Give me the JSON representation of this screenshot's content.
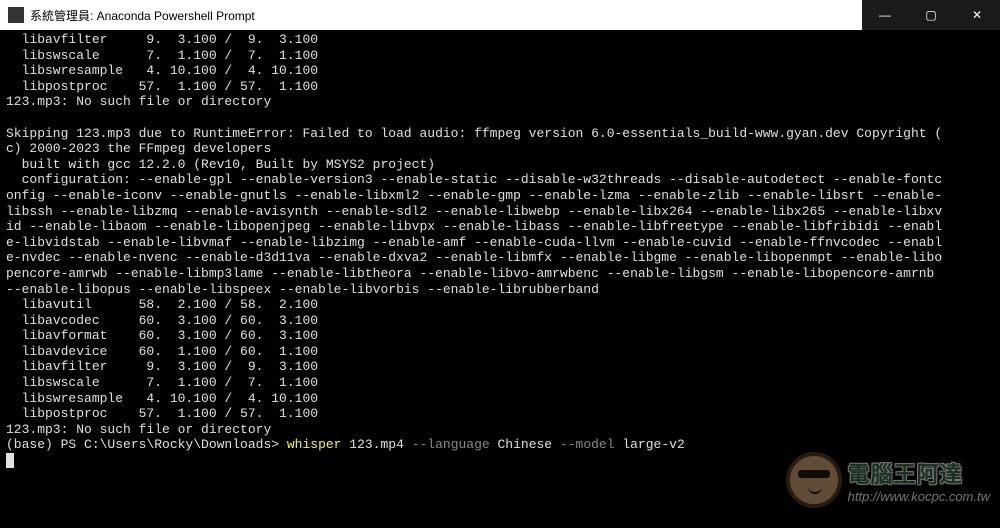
{
  "titlebar": {
    "text": "系統管理員: Anaconda Powershell Prompt",
    "min": "—",
    "max": "▢",
    "close": "✕"
  },
  "terminal": {
    "lines": [
      "  libavfilter     9.  3.100 /  9.  3.100",
      "  libswscale      7.  1.100 /  7.  1.100",
      "  libswresample   4. 10.100 /  4. 10.100",
      "  libpostproc    57.  1.100 / 57.  1.100",
      "123.mp3: No such file or directory",
      "",
      "Skipping 123.mp3 due to RuntimeError: Failed to load audio: ffmpeg version 6.0-essentials_build-www.gyan.dev Copyright (",
      "c) 2000-2023 the FFmpeg developers",
      "  built with gcc 12.2.0 (Rev10, Built by MSYS2 project)",
      "  configuration: --enable-gpl --enable-version3 --enable-static --disable-w32threads --disable-autodetect --enable-fontc",
      "onfig --enable-iconv --enable-gnutls --enable-libxml2 --enable-gmp --enable-lzma --enable-zlib --enable-libsrt --enable-",
      "libssh --enable-libzmq --enable-avisynth --enable-sdl2 --enable-libwebp --enable-libx264 --enable-libx265 --enable-libxv",
      "id --enable-libaom --enable-libopenjpeg --enable-libvpx --enable-libass --enable-libfreetype --enable-libfribidi --enabl",
      "e-libvidstab --enable-libvmaf --enable-libzimg --enable-amf --enable-cuda-llvm --enable-cuvid --enable-ffnvcodec --enabl",
      "e-nvdec --enable-nvenc --enable-d3d11va --enable-dxva2 --enable-libmfx --enable-libgme --enable-libopenmpt --enable-libo",
      "pencore-amrwb --enable-libmp3lame --enable-libtheora --enable-libvo-amrwbenc --enable-libgsm --enable-libopencore-amrnb ",
      "--enable-libopus --enable-libspeex --enable-libvorbis --enable-librubberband",
      "  libavutil      58.  2.100 / 58.  2.100",
      "  libavcodec     60.  3.100 / 60.  3.100",
      "  libavformat    60.  3.100 / 60.  3.100",
      "  libavdevice    60.  1.100 / 60.  1.100",
      "  libavfilter     9.  3.100 /  9.  3.100",
      "  libswscale      7.  1.100 /  7.  1.100",
      "  libswresample   4. 10.100 /  4. 10.100",
      "  libpostproc    57.  1.100 / 57.  1.100",
      "123.mp3: No such file or directory",
      ""
    ],
    "prompt_prefix": "(base) PS C:\\Users\\Rocky\\Downloads> ",
    "cmd_word": "whisper",
    "cmd_arg_file": " 123.mp4 ",
    "cmd_flag1": "--language",
    "cmd_flag1_val": " Chinese ",
    "cmd_flag2": "--model",
    "cmd_flag2_val": " large-v2"
  },
  "watermark": {
    "title": "電腦王阿達",
    "url": "http://www.kocpc.com.tw"
  }
}
